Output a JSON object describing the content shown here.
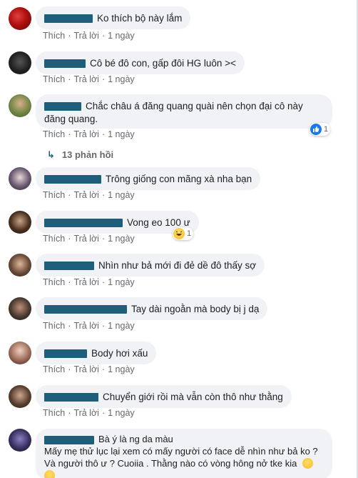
{
  "actions": {
    "like": "Thích",
    "reply": "Trả lời",
    "time": "1 ngày",
    "sep": "·"
  },
  "comments": [
    {
      "text": "Ko thích bộ này lắm"
    },
    {
      "text": "Cô bé đô con, gấp đôi HG luôn ><"
    },
    {
      "text_line1": "Chắc châu á đăng quang quài nên chọn đại cô này",
      "text_line2": "đăng quang.",
      "reaction": {
        "icon": "like-icon",
        "count": "1"
      }
    },
    {
      "text": "Trông giống con mãng xà nha bạn"
    },
    {
      "text": "Vong eo 100 ư",
      "reaction": {
        "icon": "laugh-emoji-icon",
        "count": "1"
      }
    },
    {
      "text": "Nhìn như bả mới đi đẻ dề đô thấy sợ"
    },
    {
      "text": "Tay dài ngoằn mà body bị j dạ"
    },
    {
      "text": "Body hơi xấu"
    },
    {
      "text": "Chuyển giới rồi mà vẫn còn thô như thằng"
    },
    {
      "text_line1": "Bà ý là ng da màu",
      "text_line2": "Mấy mẹ thử lục lại xem có mấy người có face dễ nhìn như bả ko ?",
      "text_line3": "Và người thô ư ? Cuoiia . Thằng nào có vòng hông nở tke kia"
    }
  ],
  "replies": {
    "label": "13 phản hồi"
  },
  "colors": {
    "bubble": "#f0f2f5",
    "redaction": "#1f5e7a",
    "meta": "#65676b",
    "like_blue": "#1877f2"
  }
}
